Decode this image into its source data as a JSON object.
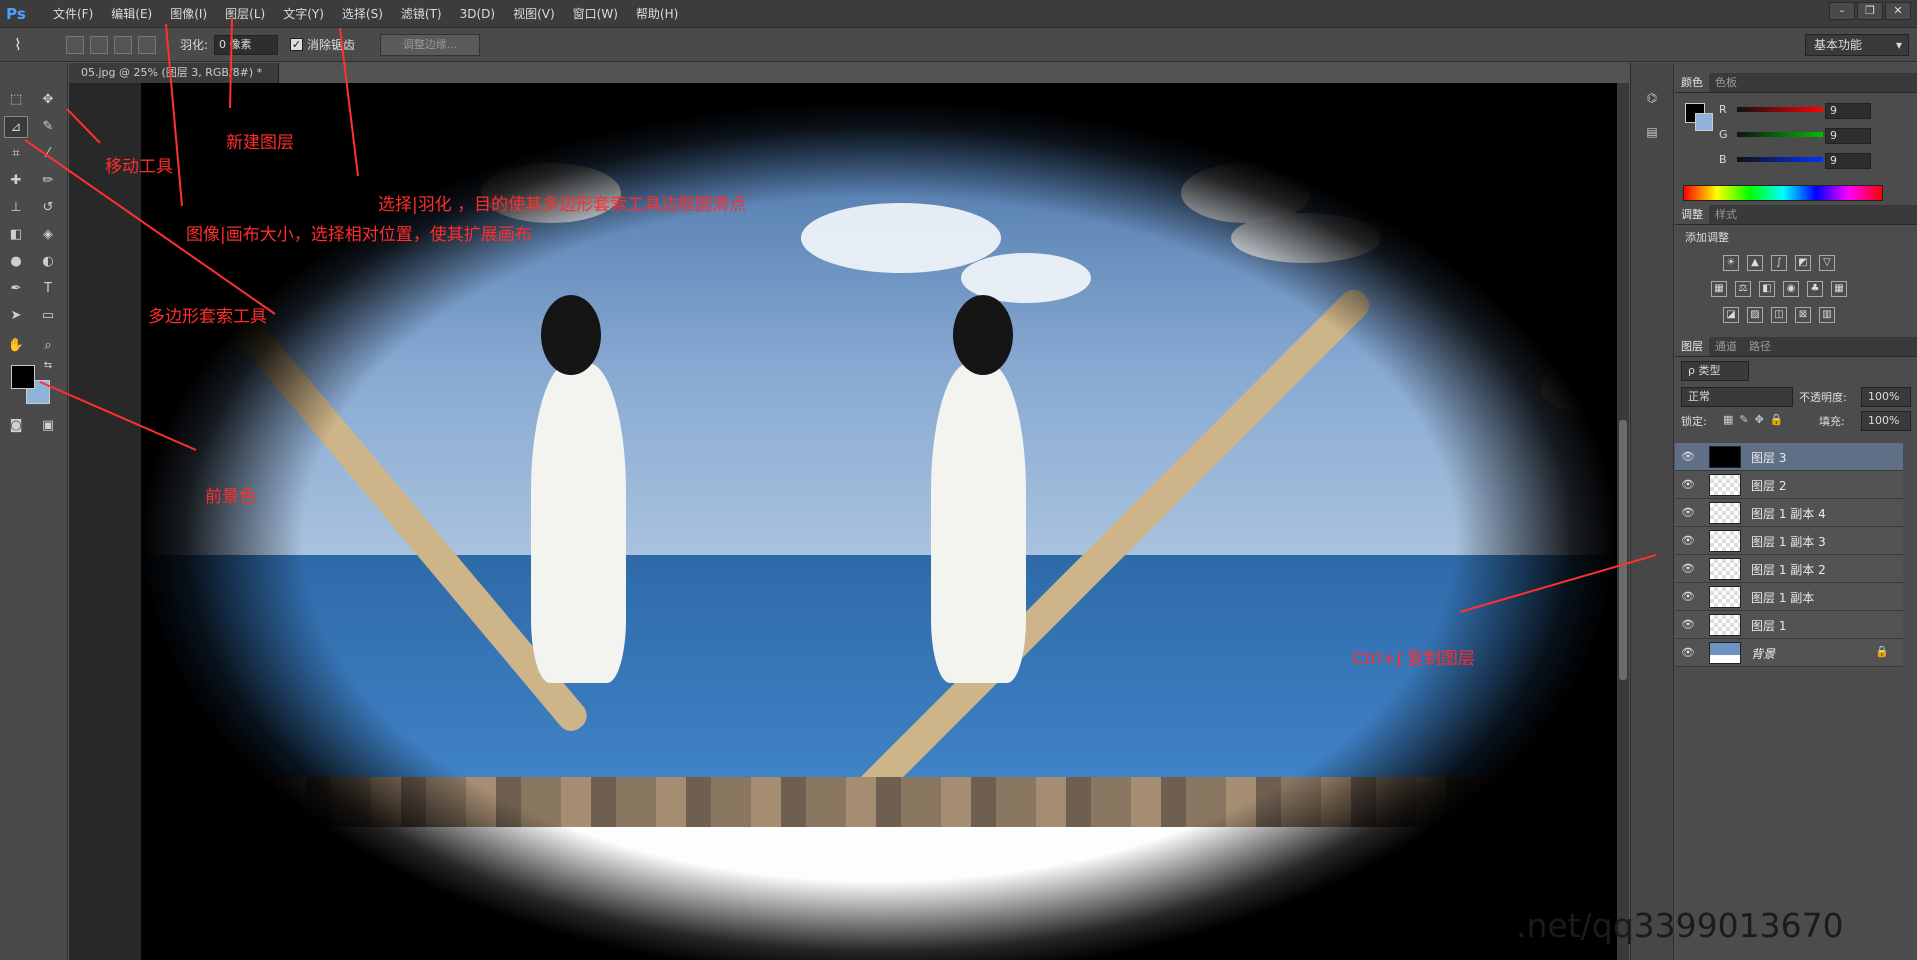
{
  "app": {
    "logo": "Ps"
  },
  "menu": [
    "文件(F)",
    "编辑(E)",
    "图像(I)",
    "图层(L)",
    "文字(Y)",
    "选择(S)",
    "滤镜(T)",
    "3D(D)",
    "视图(V)",
    "窗口(W)",
    "帮助(H)"
  ],
  "window_controls": [
    "–",
    "❐",
    "✕"
  ],
  "options": {
    "feather_label": "羽化:",
    "feather_value": "0 像素",
    "antialias_label": "消除锯齿",
    "refine_edge": "调整边缘...",
    "workspace": "基本功能"
  },
  "document": {
    "tab_title": "05.jpg @ 25% (图层 3, RGB/8#) *"
  },
  "color_panel": {
    "tabs": [
      "颜色",
      "色板"
    ],
    "rows": [
      {
        "label": "R",
        "value": "9",
        "color": "#ff0000"
      },
      {
        "label": "G",
        "value": "9",
        "color": "#00c000"
      },
      {
        "label": "B",
        "value": "9",
        "color": "#0033ff"
      }
    ]
  },
  "adjustments_panel": {
    "tabs": [
      "调整",
      "样式"
    ],
    "title": "添加调整"
  },
  "layers_panel": {
    "tabs": [
      "图层",
      "通道",
      "路径"
    ],
    "filter": "ρ 类型",
    "blend_mode": "正常",
    "opacity_label": "不透明度:",
    "opacity": "100%",
    "lock_label": "锁定:",
    "fill_label": "填充:",
    "fill": "100%",
    "layers": [
      {
        "name": "图层 3",
        "selected": true
      },
      {
        "name": "图层 2",
        "selected": false
      },
      {
        "name": "图层 1 副本 4",
        "selected": false
      },
      {
        "name": "图层 1 副本 3",
        "selected": false
      },
      {
        "name": "图层 1 副本 2",
        "selected": false
      },
      {
        "name": "图层 1 副本",
        "selected": false
      },
      {
        "name": "图层 1",
        "selected": false
      },
      {
        "name": "背景",
        "selected": false,
        "locked": true
      }
    ]
  },
  "annotations": {
    "move_tool": "移动工具",
    "new_layer": "新建图层",
    "feather": "选择|羽化 ，目的使其多边形套索工具边框圆滑点",
    "canvas_size": "图像|画布大小，选择相对位置，使其扩展画布",
    "polygon_lasso": "多边形套索工具",
    "foreground_color": "前景色",
    "duplicate_layer": "Ctrl+J 复制图层"
  },
  "watermark": ".net/qq3399013670"
}
